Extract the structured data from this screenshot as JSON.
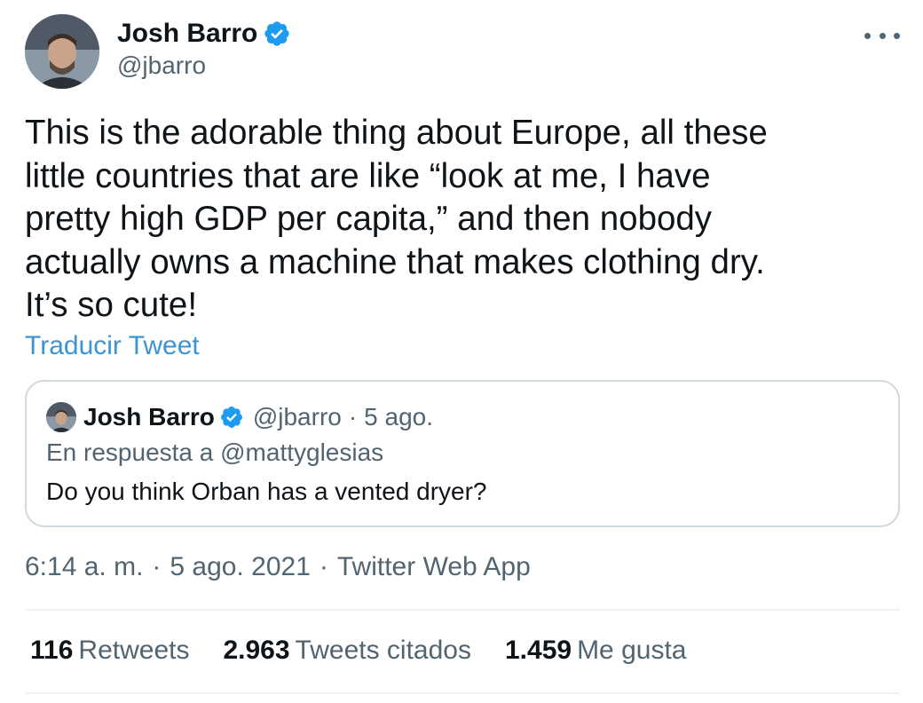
{
  "author": {
    "name": "Josh Barro",
    "handle": "@jbarro"
  },
  "tweet": {
    "text": "This is the adorable thing about Europe, all these\nlittle countries that are like “look at me, I have\npretty high GDP per capita,” and then nobody\nactually owns a machine that makes clothing dry.\nIt’s so cute!",
    "translate_label": "Traducir Tweet"
  },
  "quoted": {
    "name": "Josh Barro",
    "handle": "@jbarro",
    "separator": "·",
    "date": "5 ago.",
    "reply_to": "En respuesta a @mattyglesias",
    "text": "Do you think Orban has a vented dryer?"
  },
  "meta": {
    "time": "6:14 a. m.",
    "separator": "·",
    "date": "5 ago. 2021",
    "source": "Twitter Web App"
  },
  "stats": {
    "retweets_count": "116",
    "retweets_label": "Retweets",
    "quotes_count": "2.963",
    "quotes_label": "Tweets citados",
    "likes_count": "1.459",
    "likes_label": "Me gusta"
  },
  "icons": {
    "verified": "verified-badge-icon",
    "more": "more-options-icon"
  },
  "colors": {
    "verified": "#1d9bf0",
    "link": "#3a94d6",
    "secondary_text": "#536471",
    "border": "#cfd9de"
  }
}
